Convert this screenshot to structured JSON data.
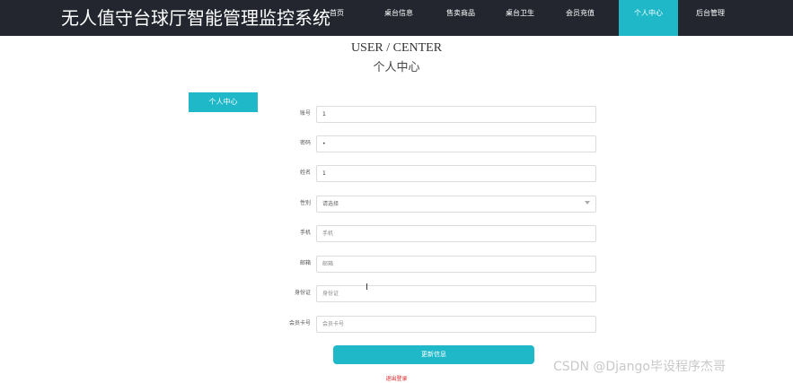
{
  "site": {
    "title": "无人值守台球厅智能管理监控系统"
  },
  "nav": {
    "items": [
      {
        "label": "首页"
      },
      {
        "label": "桌台信息"
      },
      {
        "label": "售卖商品"
      },
      {
        "label": "桌台卫生"
      },
      {
        "label": "会员充值"
      },
      {
        "label": "个人中心"
      },
      {
        "label": "后台管理"
      }
    ],
    "active": "个人中心"
  },
  "page": {
    "heading_en": "USER / CENTER",
    "heading_cn": "个人中心"
  },
  "sidebar": {
    "tab_label": "个人中心"
  },
  "form": {
    "account": {
      "label": "账号",
      "value": "1"
    },
    "password": {
      "label": "密码",
      "value": "•"
    },
    "name": {
      "label": "姓名",
      "value": "1"
    },
    "gender": {
      "label": "性别",
      "value": "请选择"
    },
    "phone": {
      "label": "手机",
      "placeholder": "手机"
    },
    "email": {
      "label": "邮箱",
      "placeholder": "邮箱"
    },
    "id_card": {
      "label": "身份证",
      "placeholder": "身份证"
    },
    "member_card": {
      "label": "会员卡号",
      "placeholder": "会员卡号"
    }
  },
  "actions": {
    "update_label": "更新信息",
    "logout_label": "退出登录"
  },
  "watermark": {
    "text": "CSDN @Django毕设程序杰哥"
  },
  "colors": {
    "topbar": "#23262f",
    "accent": "#1fb8c9",
    "logout": "#e02020"
  }
}
